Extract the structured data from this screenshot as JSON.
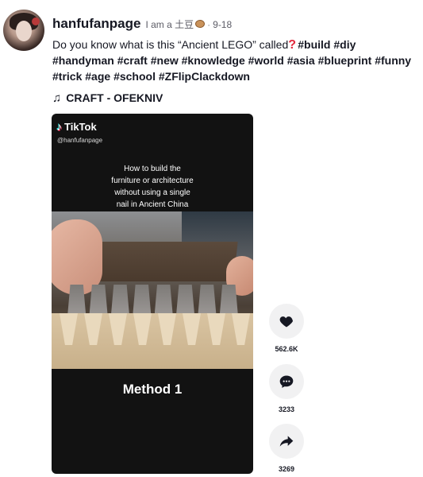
{
  "post": {
    "username": "hanfufanpage",
    "bio": "I am a 土豆",
    "date": "9-18",
    "caption_text": "Do you know what is this “Ancient LEGO” called",
    "hashtags": [
      "#build",
      "#diy",
      "#handyman",
      "#craft",
      "#new",
      "#knowledge",
      "#world",
      "#asia",
      "#blueprint",
      "#funny",
      "#trick",
      "#age",
      "#school",
      "#ZFlipClackdown"
    ],
    "music": "CRAFT - OFEKNIV"
  },
  "video": {
    "brand": "TikTok",
    "handle": "@hanfufanpage",
    "overlay_text": "How to build the\nfurniture or architecture\nwithout using a single\nnail in Ancient China",
    "subtitle": "Method 1"
  },
  "actions": {
    "likes": "562.6K",
    "comments": "3233",
    "shares": "3269"
  },
  "icons": {
    "music": "music-note-icon",
    "like": "heart-icon",
    "comment": "comment-icon",
    "share": "share-icon",
    "brand": "tiktok-logo-icon"
  }
}
